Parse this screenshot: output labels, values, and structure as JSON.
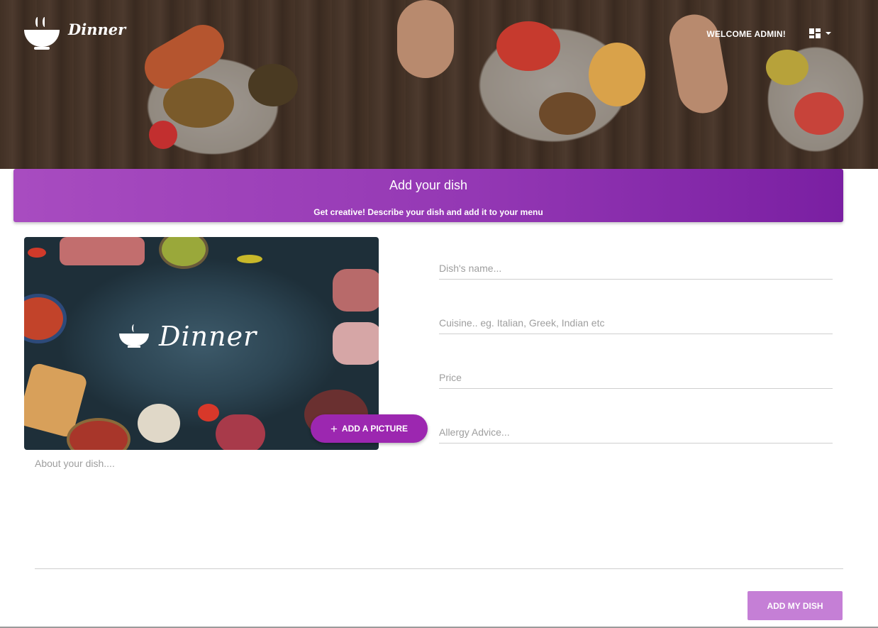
{
  "header": {
    "brand": "Dinner",
    "welcome": "WELCOME ADMIN!",
    "menu_icon": "dashboard-icon"
  },
  "banner": {
    "title": "Add your dish",
    "subtitle": "Get creative! Describe your dish and add it to your menu"
  },
  "picture": {
    "logo_text": "Dinner",
    "add_button_label": "ADD A PICTURE"
  },
  "form": {
    "name_placeholder": "Dish's name...",
    "cuisine_placeholder": "Cuisine.. eg. Italian, Greek, Indian etc",
    "price_placeholder": "Price",
    "allergy_placeholder": "Allergy Advice...",
    "about_placeholder": "About your dish....",
    "submit_label": "ADD MY DISH"
  },
  "colors": {
    "accent": "#9c27b0",
    "banner_start": "#a84cc0",
    "banner_end": "#7a1fa2",
    "submit": "#c57fd6"
  }
}
